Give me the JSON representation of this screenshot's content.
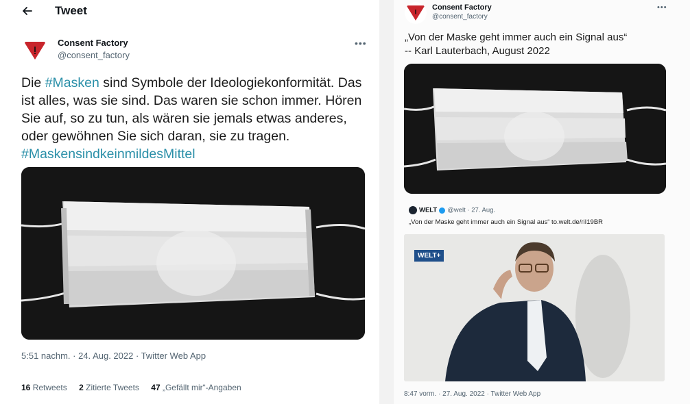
{
  "left": {
    "header": {
      "title": "Tweet"
    },
    "author": {
      "name": "Consent Factory",
      "handle": "@consent_factory"
    },
    "tweet": {
      "hashtag1": "#Masken",
      "text_before": "Die ",
      "text_after": " sind Symbole der Ideologiekonformität. Das ist alles, was sie sind. Das waren sie schon immer. Hören Sie auf, so zu tun, als wären sie jemals etwas anderes, oder gewöhnen Sie sich daran, sie zu tragen.",
      "hashtag2": "#MaskensindkeinmildesMittel"
    },
    "timestamp": "5:51 nachm. · 24. Aug. 2022 · Twitter Web App",
    "stats": {
      "retweets_count": "16",
      "retweets_label": "Retweets",
      "quotes_count": "2",
      "quotes_label": "Zitierte Tweets",
      "likes_count": "47",
      "likes_label": "„Gefällt mir“-Angaben"
    }
  },
  "right": {
    "author": {
      "name": "Consent Factory",
      "handle": "@consent_factory"
    },
    "quote_line1": "„Von der Maske geht immer auch ein Signal aus“",
    "quote_line2": "-- Karl Lauterbach, August 2022",
    "quoted": {
      "name": "WELT",
      "handle_date": "@welt · 27. Aug.",
      "text": "„Von der Maske geht immer auch ein Signal aus“ to.welt.de/riI19BR",
      "badge": "WELT+"
    },
    "timestamp": "8:47 vorm. · 27. Aug. 2022 · Twitter Web App"
  },
  "colors": {
    "hashtag": "#2a8fa8",
    "avatar_red": "#c8252c",
    "secondary_text": "#536471"
  }
}
